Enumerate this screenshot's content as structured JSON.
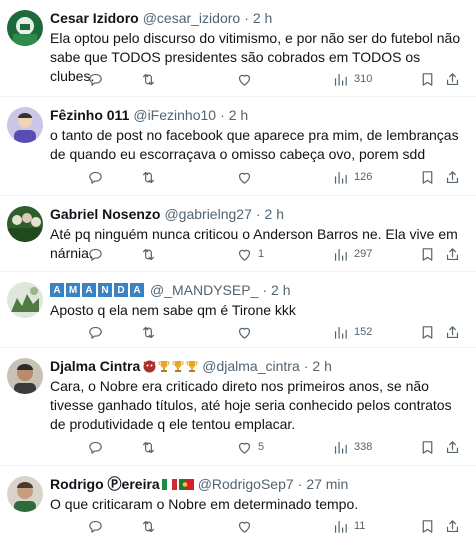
{
  "tweets": [
    {
      "name": "Cesar Izidoro",
      "handle": "@cesar_izidoro",
      "sep": "·",
      "time": "2 h",
      "text": "Ela optou pelo discurso do vitimismo, e por não ser do futebol não sabe que TODOS presidentes são cobrados em TODOS os clubes.",
      "reply_count": "",
      "retweet_count": "",
      "like_count": "",
      "views": "310"
    },
    {
      "name": "Fêzinho 011",
      "handle": "@iFezinho10",
      "sep": "·",
      "time": "2 h",
      "text": "o tanto de post no facebook que aparece pra mim, de lembranças de quando eu escorraçava o omisso cabeça ovo, porem sdd",
      "reply_count": "",
      "retweet_count": "",
      "like_count": "",
      "views": "126"
    },
    {
      "name": "Gabriel Nosenzo",
      "handle": "@gabrielng27",
      "sep": "·",
      "time": "2 h",
      "text": "Até pq ninguém nunca criticou o Anderson Barros ne. Ela vive em nárnia.",
      "reply_count": "",
      "retweet_count": "",
      "like_count": "1",
      "views": "297"
    },
    {
      "name_letters": [
        "A",
        "M",
        "A",
        "N",
        "D",
        "A"
      ],
      "handle": "@_MANDYSEP_",
      "sep": "·",
      "time": "2 h",
      "text": "Aposto q ela nem sabe qm é Tirone kkk",
      "reply_count": "",
      "retweet_count": "",
      "like_count": "",
      "views": "152"
    },
    {
      "name": "Djalma Cintra",
      "handle": "@djalma_cintra",
      "sep": "·",
      "time": "2 h",
      "text": "Cara, o Nobre era criticado direto nos primeiros anos, se não tivesse ganhado títulos, até hoje seria conhecido pelos contratos de produtividade q ele tentou emplacar.",
      "reply_count": "",
      "retweet_count": "",
      "like_count": "5",
      "views": "338"
    },
    {
      "name": "Rodrigo Ⓟereira",
      "handle": "@RodrigoSep7",
      "sep": "·",
      "time": "27 min",
      "text": "O que criticaram o Nobre em determinado tempo.",
      "reply_count": "",
      "retweet_count": "",
      "like_count": "",
      "views": "11"
    }
  ],
  "colors": {
    "text": "#0f1419",
    "muted": "#536471",
    "border": "#eff3f4",
    "badge": "#3b82c4"
  },
  "icons": [
    "reply-icon",
    "retweet-icon",
    "like-icon",
    "views-icon",
    "bookmark-icon",
    "share-icon"
  ]
}
